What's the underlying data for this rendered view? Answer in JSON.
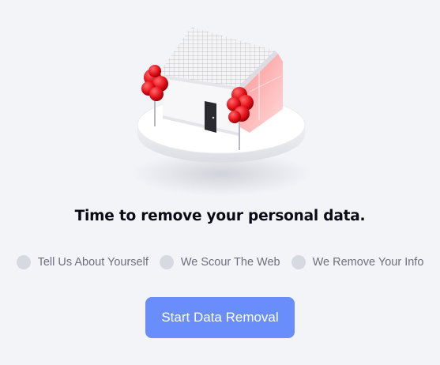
{
  "hero": {
    "illustration": "house-with-red-trees-illustration"
  },
  "headline": "Time to remove your personal data.",
  "steps": [
    {
      "icon": "step-circle-icon",
      "label": "Tell Us About Yourself"
    },
    {
      "icon": "step-circle-icon",
      "label": "We Scour The Web"
    },
    {
      "icon": "step-circle-icon",
      "label": "We Remove Your Info"
    }
  ],
  "cta": {
    "label": "Start Data Removal"
  },
  "colors": {
    "background": "#f3f4f8",
    "accent": "#6a8dfc",
    "step_dot": "#d7d9e1",
    "step_text": "#6e6f7e",
    "tree_red": "#e8141e"
  }
}
